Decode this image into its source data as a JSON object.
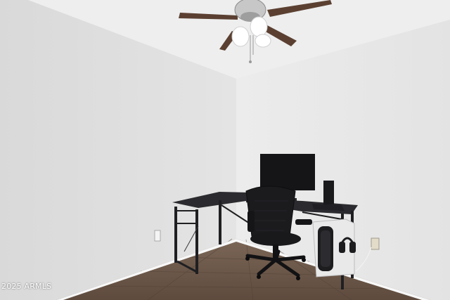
{
  "watermark": {
    "text": "2025 ARMLS"
  },
  "colors": {
    "left_wall": "#e1e1e1",
    "right_wall": "#e9e9e9",
    "ceiling": "#ededed",
    "floor": "#6e5a4b",
    "furniture": "#1f1f22"
  }
}
